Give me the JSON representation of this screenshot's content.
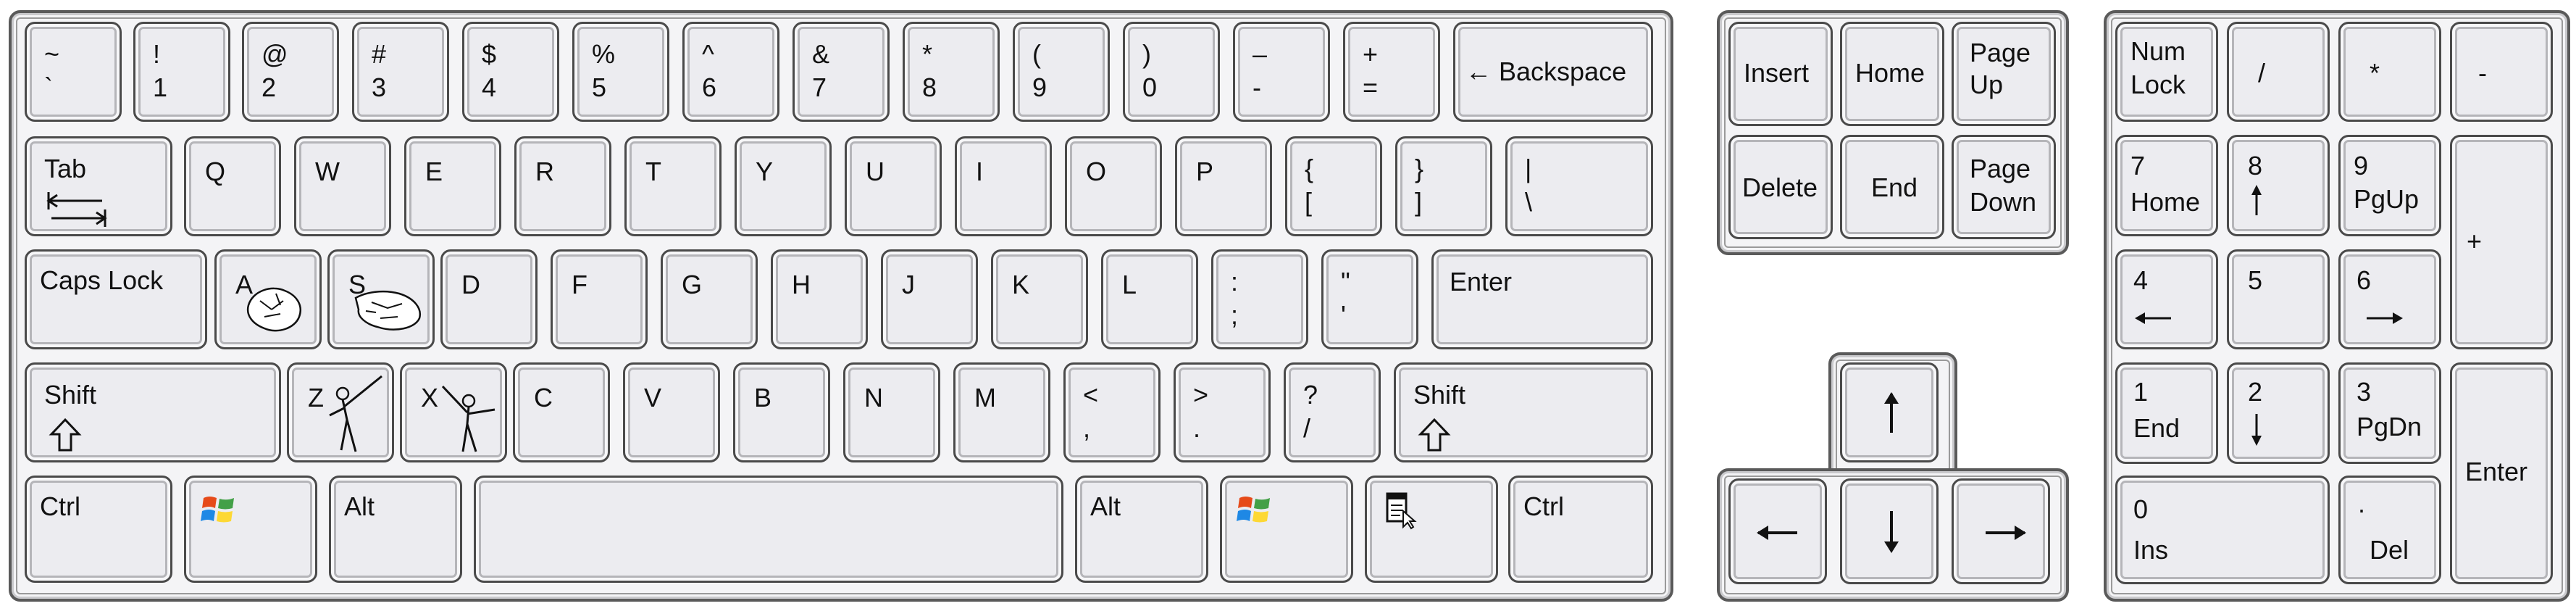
{
  "keyboard": {
    "row1": [
      {
        "top": "~",
        "bottom": "`"
      },
      {
        "top": "!",
        "bottom": "1"
      },
      {
        "top": "@",
        "bottom": "2"
      },
      {
        "top": "#",
        "bottom": "3"
      },
      {
        "top": "$",
        "bottom": "4"
      },
      {
        "top": "%",
        "bottom": "5"
      },
      {
        "top": "^",
        "bottom": "6"
      },
      {
        "top": "&",
        "bottom": "7"
      },
      {
        "top": "*",
        "bottom": "8"
      },
      {
        "top": "(",
        "bottom": "9"
      },
      {
        "top": ")",
        "bottom": "0"
      },
      {
        "top": "–",
        "bottom": "-"
      },
      {
        "top": "+",
        "bottom": "="
      }
    ],
    "backspace": "Backspace",
    "tab": "Tab",
    "row2_letters": [
      "Q",
      "W",
      "E",
      "R",
      "T",
      "Y",
      "U",
      "I",
      "O",
      "P"
    ],
    "row2_sym": [
      {
        "top": "{",
        "bottom": "["
      },
      {
        "top": "}",
        "bottom": "]"
      },
      {
        "top": "|",
        "bottom": "\\"
      }
    ],
    "caps": "Caps Lock",
    "row3_letters": [
      "A",
      "S",
      "D",
      "F",
      "G",
      "H",
      "J",
      "K",
      "L"
    ],
    "row3_sym": [
      {
        "top": ":",
        "bottom": ";"
      },
      {
        "top": "\"",
        "bottom": "'"
      }
    ],
    "enter": "Enter",
    "shift": "Shift",
    "row4_letters": [
      "Z",
      "X",
      "C",
      "V",
      "B",
      "N",
      "M"
    ],
    "row4_sym": [
      {
        "top": "<",
        "bottom": ","
      },
      {
        "top": ">",
        "bottom": "."
      },
      {
        "top": "?",
        "bottom": "/"
      }
    ],
    "ctrl": "Ctrl",
    "alt": "Alt"
  },
  "nav": {
    "insert": "Insert",
    "home": "Home",
    "pageup": [
      "Page",
      "Up"
    ],
    "delete": "Delete",
    "end": "End",
    "pagedown": [
      "Page",
      "Down"
    ]
  },
  "numpad": {
    "numlock": [
      "Num",
      "Lock"
    ],
    "slash": "/",
    "star": "*",
    "minus": "-",
    "plus": "+",
    "enter": "Enter",
    "k7": [
      "7",
      "Home"
    ],
    "k8": "8",
    "k9": [
      "9",
      "PgUp"
    ],
    "k4": "4",
    "k5": "5",
    "k6": "6",
    "k1": [
      "1",
      "End"
    ],
    "k2": "2",
    "k3": [
      "3",
      "PgDn"
    ],
    "k0": [
      "0",
      "Ins"
    ],
    "kdot": [
      ".",
      "Del"
    ]
  },
  "icons": {
    "windows": "windows-logo-icon",
    "menu": "context-menu-icon",
    "arrow_up": "arrow-up-icon",
    "arrow_down": "arrow-down-icon",
    "arrow_left": "arrow-left-icon",
    "arrow_right": "arrow-right-icon",
    "shift_arrow": "shift-arrow-icon",
    "tab_arrows": "tab-arrows-icon",
    "fist_a": "fist-sketch-icon",
    "hand_s": "hand-sketch-icon",
    "kick_z": "kicking-figure-icon",
    "kick_x": "kicking-figure-icon"
  },
  "colors": {
    "key_face": "#ececf0",
    "key_border": "#4a4a4a",
    "block_bg": "#f4f4f6"
  }
}
